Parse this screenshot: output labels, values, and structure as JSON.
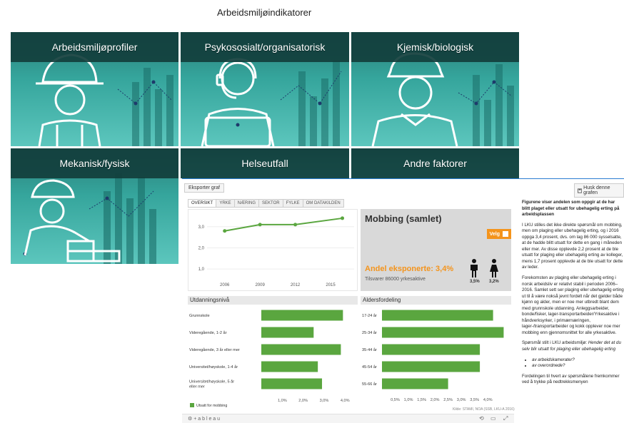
{
  "page": {
    "title": "Arbeidsmiljøindikatorer"
  },
  "tiles": [
    {
      "label": "Arbeidsmiljøprofiler",
      "icon": "construction-worker-icon"
    },
    {
      "label": "Psykososialt/organisatorisk",
      "icon": "headset-operator-icon"
    },
    {
      "label": "Kjemisk/biologisk",
      "icon": "painter-icon"
    },
    {
      "label": "Mekanisk/fysisk",
      "icon": "bricklayer-icon"
    },
    {
      "label": "Helseutfall",
      "icon": "chart-icon"
    },
    {
      "label": "Andre faktorer",
      "icon": "chart-icon"
    }
  ],
  "viz": {
    "export_label": "Eksporter graf",
    "save_label": "Husk denne grafen",
    "tabs": [
      "OVERSIKT",
      "YRKE",
      "NÆRING",
      "SEKTOR",
      "FYLKE",
      "OM DATAKILDEN"
    ],
    "headline": "Mobbing (samlet)",
    "velg_label": "Velg",
    "andel_label": "Andel eksponerte: 3,4%",
    "tilsvarer_label": "Tilsvarer 86000 yrkesaktive",
    "male_pct": "3,5%",
    "female_pct": "3,2%",
    "education_title": "Utdanningsnivå",
    "age_title": "Aldersfordeling",
    "legend_label": "Utsatt for mobbing",
    "source": "Kilde: STAMI, NOA (SSB, LKU-A 2016)",
    "tableau_label": "+ a b l e a u",
    "accent_color": "#f4941c",
    "bar_color": "#5aa63f",
    "line_color": "#5aa63f"
  },
  "chart_data": [
    {
      "type": "line",
      "x": [
        2006,
        2009,
        2012,
        2016
      ],
      "series": [
        {
          "values": [
            2.8,
            3.1,
            3.1,
            3.4
          ]
        }
      ],
      "xticks": [
        "2006",
        "2009",
        "2012",
        "2015"
      ],
      "yticks": [
        "1,0",
        "2,0",
        "3,0"
      ],
      "ylim": [
        0.5,
        3.6
      ],
      "xlim": [
        2004.5,
        2017
      ]
    },
    {
      "type": "bar",
      "title": "Utdanningsnivå",
      "categories": [
        "Grunnskole",
        "Videregående, 1-2 år",
        "Videregående, 3 år eller mer",
        "Universitet/høyskole, 1-4 år",
        "Universitet/høyskole, 5 år eller mer"
      ],
      "series": [
        {
          "name": "Utsatt for mobbing",
          "values": [
            3.9,
            2.5,
            3.8,
            2.7,
            2.9
          ]
        }
      ],
      "xticks": [
        "1,0%",
        "2,0%",
        "3,0%",
        "4,0%"
      ],
      "xlim": [
        0,
        4.4
      ]
    },
    {
      "type": "bar",
      "title": "Aldersfordeling",
      "categories": [
        "17-24 år",
        "25-34 år",
        "35-44 år",
        "45-54 år",
        "55-66 år"
      ],
      "series": [
        {
          "values": [
            4.2,
            4.6,
            3.7,
            3.7,
            2.5
          ]
        }
      ],
      "xticks": [
        "0,5%",
        "1,0%",
        "1,5%",
        "2,0%",
        "2,5%",
        "3,0%",
        "3,5%",
        "4,0%"
      ],
      "xlim": [
        0,
        4.75
      ]
    }
  ],
  "text": {
    "heading": "Figurene viser andelen som oppgir at de har blitt plaget eller utsatt for ubehagelig erting på arbeidsplassen",
    "p1": "I LKU stilles det ikke direkte spørsmål om mobbing, men om plaging eller ubehagelig erting, og i 2016 oppga 3,4 prosent, dvs. om lag 86 000 sysselsatte, at de hadde blitt utsatt for dette en gang i måneden eller mer. Av disse opplevde 2,2 prosent at de ble utsatt for plaging eller ubehagelig erting av kolleger, mens 1,7 prosent opplevde at de ble utsatt for dette av leder.",
    "p2": "Forekomsten av plaging eller ubehagelig erting i norsk arbeidsliv er relativt stabil i perioden 2006–2016. Samlet sett ser plaging eller ubehagelig erting ut til å være nokså jevnt fordelt når det gjelder både kjønn og alder, men er noe mer utbredt blant dem med grunnskole utdanning. Anleggsarbeider, bonde/fisker, lager-transportarbeider/Yrkesaktive i håndverksyrker, i primærnæringen, lager-/transportarbeider og kokk opplever noe mer mobbing enn gjennomsnittet for alle yrkesaktive.",
    "p3_prefix": "Spørsmål stilt i LKU arbeidsmiljø: ",
    "p3_italic": "Hender det at du selv blir utsatt for plaging eller ubehagelig erting",
    "li1": "av arbeidskamerater?",
    "li2": "av overordnede?",
    "p4": "Fordelingen til hvert av spørsmålene fremkommer ved å trykke på nedtrekksmenyen"
  }
}
